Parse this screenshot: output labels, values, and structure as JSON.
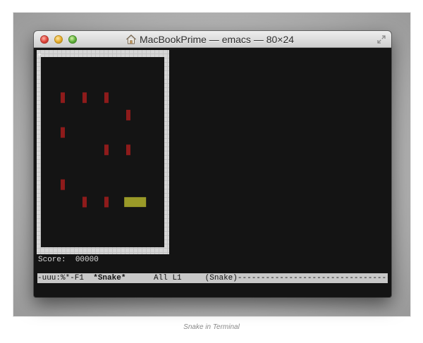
{
  "window": {
    "title": "MacBookPrime — emacs — 80×24"
  },
  "game": {
    "corner_marker": "+",
    "score_label": "Score:",
    "score_value": "00000",
    "foods": [
      {
        "col": 0,
        "row": 1
      },
      {
        "col": 1,
        "row": 1
      },
      {
        "col": 2,
        "row": 1
      },
      {
        "col": 3,
        "row": 2
      },
      {
        "col": 0,
        "row": 3
      },
      {
        "col": 2,
        "row": 4
      },
      {
        "col": 3,
        "row": 4
      },
      {
        "col": 0,
        "row": 6
      },
      {
        "col": 1,
        "row": 7
      },
      {
        "col": 2,
        "row": 7
      }
    ],
    "snake": {
      "head_col": 3.2,
      "row": 7,
      "length": 2
    }
  },
  "modeline": {
    "status": "-uuu:%*-F1",
    "buffer": "*Snake*",
    "position": "All L1",
    "mode": "(Snake)"
  },
  "caption": "Snake in Terminal",
  "colors": {
    "food": "#8e1b1b",
    "snake": "#9a9a28",
    "wall": "#c4c4c4",
    "background": "#141414"
  }
}
